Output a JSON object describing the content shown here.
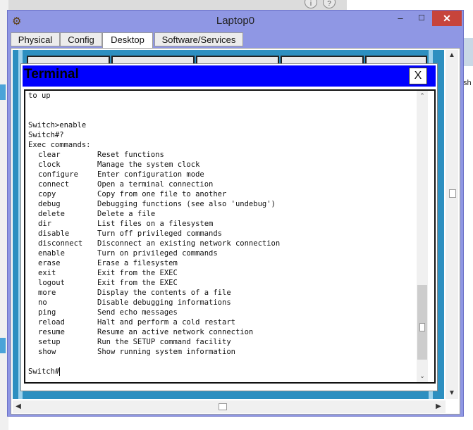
{
  "window": {
    "title": "Laptop0",
    "minimize": "–",
    "maximize": "☐",
    "close": "✕"
  },
  "tabs": [
    {
      "label": "Physical"
    },
    {
      "label": "Config"
    },
    {
      "label": "Desktop",
      "active": true
    },
    {
      "label": "Software/Services"
    }
  ],
  "terminal": {
    "title": "Terminal",
    "close": "X",
    "intro": [
      "to up",
      "",
      "",
      "Switch>enable",
      "Switch#?",
      "Exec commands:"
    ],
    "commands": [
      {
        "cmd": "clear",
        "desc": "Reset functions"
      },
      {
        "cmd": "clock",
        "desc": "Manage the system clock"
      },
      {
        "cmd": "configure",
        "desc": "Enter configuration mode"
      },
      {
        "cmd": "connect",
        "desc": "Open a terminal connection"
      },
      {
        "cmd": "copy",
        "desc": "Copy from one file to another"
      },
      {
        "cmd": "debug",
        "desc": "Debugging functions (see also 'undebug')"
      },
      {
        "cmd": "delete",
        "desc": "Delete a file"
      },
      {
        "cmd": "dir",
        "desc": "List files on a filesystem"
      },
      {
        "cmd": "disable",
        "desc": "Turn off privileged commands"
      },
      {
        "cmd": "disconnect",
        "desc": "Disconnect an existing network connection"
      },
      {
        "cmd": "enable",
        "desc": "Turn on privileged commands"
      },
      {
        "cmd": "erase",
        "desc": "Erase a filesystem"
      },
      {
        "cmd": "exit",
        "desc": "Exit from the EXEC"
      },
      {
        "cmd": "logout",
        "desc": "Exit from the EXEC"
      },
      {
        "cmd": "more",
        "desc": "Display the contents of a file"
      },
      {
        "cmd": "no",
        "desc": "Disable debugging informations"
      },
      {
        "cmd": "ping",
        "desc": "Send echo messages"
      },
      {
        "cmd": "reload",
        "desc": "Halt and perform a cold restart"
      },
      {
        "cmd": "resume",
        "desc": "Resume an active network connection"
      },
      {
        "cmd": "setup",
        "desc": "Run the SETUP command facility"
      },
      {
        "cmd": "show",
        "desc": "Show running system information"
      }
    ],
    "prompt": "Switch#"
  },
  "colors": {
    "window_frame": "#8f97e4",
    "terminal_title_bar": "#0000ff",
    "close_button": "#c7443b",
    "desktop_background": "#2d8fc0"
  },
  "icons": [
    "app-icon",
    "scroll-up-icon",
    "scroll-down-icon",
    "scroll-left-icon",
    "scroll-right-icon"
  ]
}
